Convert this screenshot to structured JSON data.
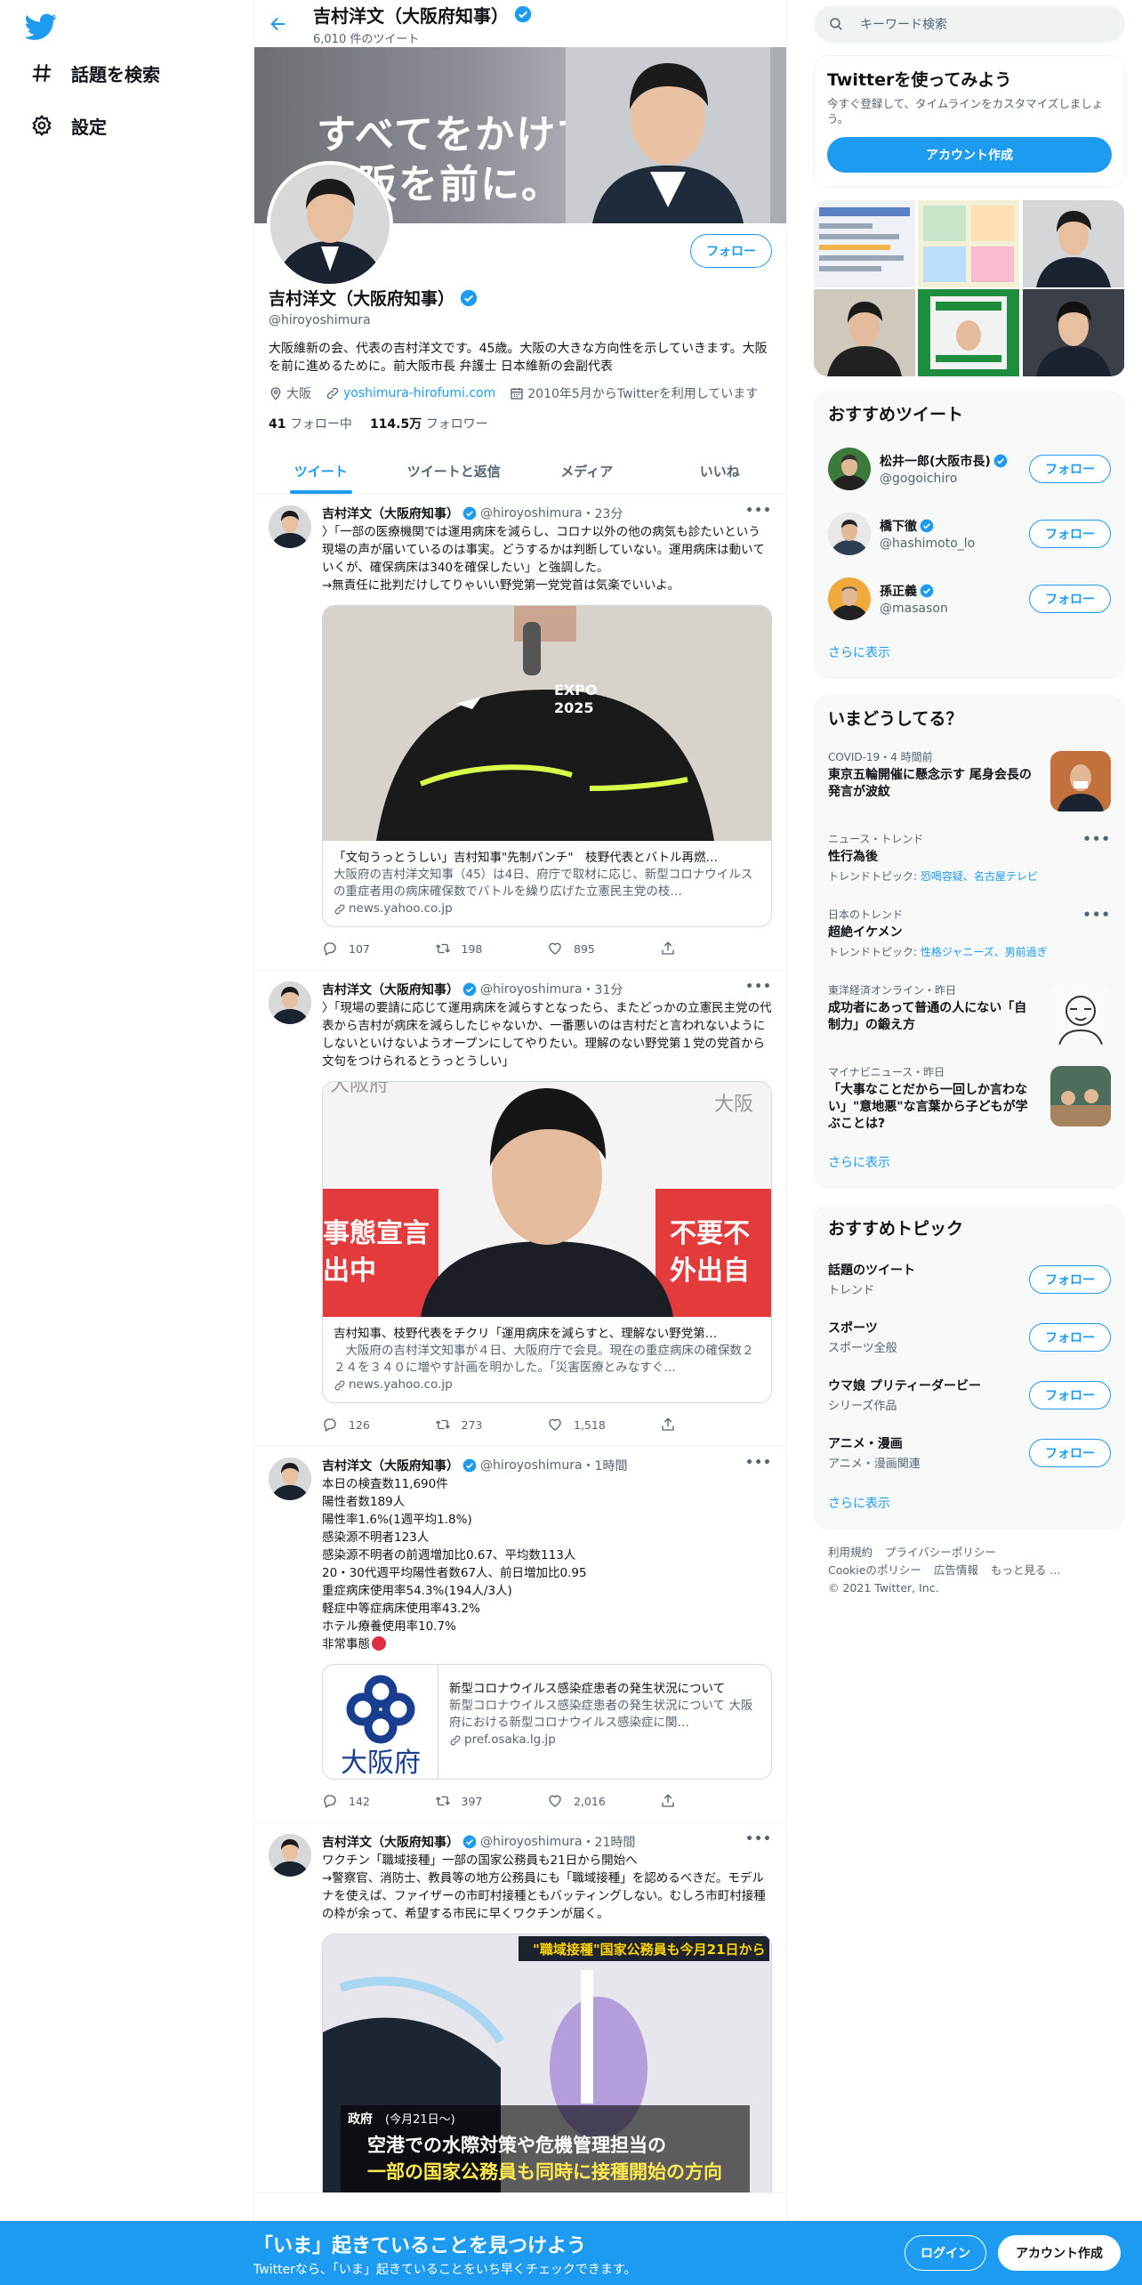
{
  "nav": {
    "explore_label": "話題を検索",
    "settings_label": "設定"
  },
  "profile": {
    "name": "吉村洋文（大阪府知事）",
    "tweet_count": "6,010 件のツイート",
    "banner_line1": "すべてをかけて、",
    "banner_line2": "大阪を前に。",
    "follow_label": "フォロー",
    "handle": "@hiroyoshimura",
    "bio": "大阪維新の会、代表の吉村洋文です。45歳。大阪の大きな方向性を示していきます。大阪を前に進めるために。前大阪市長 弁護士 日本維新の会副代表",
    "location": "大阪",
    "website": "yoshimura-hirofumi.com",
    "joined": "2010年5月からTwitterを利用しています",
    "following_count": "41",
    "following_label": "フォロー中",
    "followers_count": "114.5万",
    "followers_label": "フォロワー"
  },
  "tabs": [
    "ツイート",
    "ツイートと返信",
    "メディア",
    "いいね"
  ],
  "tweets": [
    {
      "name": "吉村洋文（大阪府知事）",
      "handle": "@hiroyoshimura",
      "time": "・23分",
      "text": "〉「一部の医療機関では運用病床を減らし、コロナ以外の他の病気も診たいという現場の声が届いているのは事実。どうするかは判断していない。運用病床は動いていくが、確保病床は340を確保したい」と強調した。\n→無責任に批判だけしてりゃいい野党第一党党首は気楽でいいよ。",
      "card_title": "「文句うっとうしい」吉村知事\"先制パンチ\"　枝野代表とバトル再燃…",
      "card_desc": "大阪府の吉村洋文知事（45）は4日、府庁で取材に応じ、新型コロナウイルスの重症者用の病床確保数でバトルを繰り広げた立憲民主党の枝…",
      "card_domain": "news.yahoo.co.jp",
      "replies": "107",
      "retweets": "198",
      "likes": "895"
    },
    {
      "name": "吉村洋文（大阪府知事）",
      "handle": "@hiroyoshimura",
      "time": "・31分",
      "text": "〉「現場の要請に応じて運用病床を減らすとなったら、またどっかの立憲民主党の代表から吉村が病床を減らしたじゃないか、一番悪いのは吉村だと言われないようにしないといけないようオープンにしてやりたい。理解のない野党第１党の党首から文句をつけられるとうっとうしい」",
      "card_title": "吉村知事、枝野代表をチクリ「運用病床を減らすと、理解ない野党第…",
      "card_desc": "　大阪府の吉村洋文知事が４日、大阪府庁で会見。現在の重症病床の確保数２２４を３４０に増やす計画を明かした。「災害医療とみなすぐ…",
      "card_domain": "news.yahoo.co.jp",
      "img_left_text1": "事態宣言",
      "img_left_text2": "出中",
      "img_right_text1": "不要不",
      "img_right_text2": "外出自",
      "img_top_left": "大阪府",
      "img_top_right": "大阪",
      "replies": "126",
      "retweets": "273",
      "likes": "1,518"
    },
    {
      "name": "吉村洋文（大阪府知事）",
      "handle": "@hiroyoshimura",
      "time": "・1時間",
      "text": "本日の検査数11,690件\n陽性者数189人\n陽性率1.6%(1週平均1.8%)\n感染源不明者123人\n感染源不明者の前週増加比0.67、平均数113人\n20・30代週平均陽性者数67人、前日増加比0.95\n重症病床使用率54.3%(194人/3人)\n軽症中等症病床使用率43.2%\nホテル療養使用率10.7%\n非常事態",
      "card_title": "新型コロナウイルス感染症患者の発生状況について",
      "card_desc": "新型コロナウイルス感染症患者の発生状況について 大阪府における新型コロナウイルス感染症に関…",
      "card_domain": "pref.osaka.lg.jp",
      "card_logo_text": "大阪府",
      "replies": "142",
      "retweets": "397",
      "likes": "2,016"
    },
    {
      "name": "吉村洋文（大阪府知事）",
      "handle": "@hiroyoshimura",
      "time": "・21時間",
      "text": "ワクチン「職域接種」一部の国家公務員も21日から開始へ\n→警察官、消防士、教員等の地方公務員にも「職域接種」を認めるべきだ。モデルナを使えば、ファイザーの市町村接種ともバッティングしない。むしろ市町村接種の枠が余って、希望する市民に早くワクチンが届く。",
      "img_caption_top": "\"職域接種\"国家公務員も今月21日から",
      "img_caption_tag": "政府",
      "img_caption_date": "(今月21日〜)",
      "img_caption_line1": "空港での水際対策や危機管理担当の",
      "img_caption_line2": "一部の国家公務員も同時に接種開始の方向"
    }
  ],
  "sidebar": {
    "search_placeholder": "キーワード検索",
    "signup_title": "Twitterを使ってみよう",
    "signup_desc": "今すぐ登録して、タイムラインをカスタマイズしましょう。",
    "signup_button": "アカウント作成",
    "rec_tweets_title": "おすすめツイート",
    "rec_users": [
      {
        "name": "松井一郎(大阪市長)",
        "handle": "@gogoichiro",
        "follow": "フォロー"
      },
      {
        "name": "橋下徹",
        "handle": "@hashimoto_lo",
        "follow": "フォロー"
      },
      {
        "name": "孫正義",
        "handle": "@masason",
        "follow": "フォロー"
      }
    ],
    "show_more": "さらに表示",
    "trends_title": "いまどうしてる？",
    "trends": [
      {
        "context": "COVID-19・4 時間前",
        "title": "東京五輪開催に懸念示す 尾身会長の発言が波紋",
        "sub_prefix": "",
        "sub_links": ""
      },
      {
        "context": "ニュース・トレンド",
        "title": "性行為後",
        "sub_prefix": "トレンドトピック: ",
        "sub_links": "恐喝容疑、名古屋テレビ"
      },
      {
        "context": "日本のトレンド",
        "title": "超絶イケメン",
        "sub_prefix": "トレンドトピック: ",
        "sub_links": "性格ジャニーズ、男前過ぎ"
      },
      {
        "context": "東洋経済オンライン・昨日",
        "title": "成功者にあって普通の人にない「自制力」の鍛え方",
        "sub_prefix": "",
        "sub_links": ""
      },
      {
        "context": "マイナビニュース・昨日",
        "title": "「大事なことだから一回しか言わない」\"意地悪\"な言葉から子どもが学ぶことは?",
        "sub_prefix": "",
        "sub_links": ""
      }
    ],
    "topics_title": "おすすめトピック",
    "topics": [
      {
        "name": "話題のツイート",
        "sub": "トレンド",
        "follow": "フォロー"
      },
      {
        "name": "スポーツ",
        "sub": "スポーツ全般",
        "follow": "フォロー"
      },
      {
        "name": "ウマ娘 プリティーダービー",
        "sub": "シリーズ作品",
        "follow": "フォロー"
      },
      {
        "name": "アニメ・漫画",
        "sub": "アニメ・漫画関連",
        "follow": "フォロー"
      }
    ],
    "footer_links": [
      "利用規約",
      "プライバシーポリシー",
      "Cookieのポリシー",
      "広告情報",
      "もっと見る ..."
    ],
    "copyright": "© 2021 Twitter, Inc."
  },
  "bottom_bar": {
    "title": "「いま」起きていることを見つけよう",
    "subtitle": "Twitterなら、「いま」起きていることをいち早くチェックできます。",
    "login": "ログイン",
    "signup": "アカウント作成"
  },
  "colors": {
    "accent": "#1d9bf0",
    "text": "#0f1419",
    "muted": "#536471"
  }
}
